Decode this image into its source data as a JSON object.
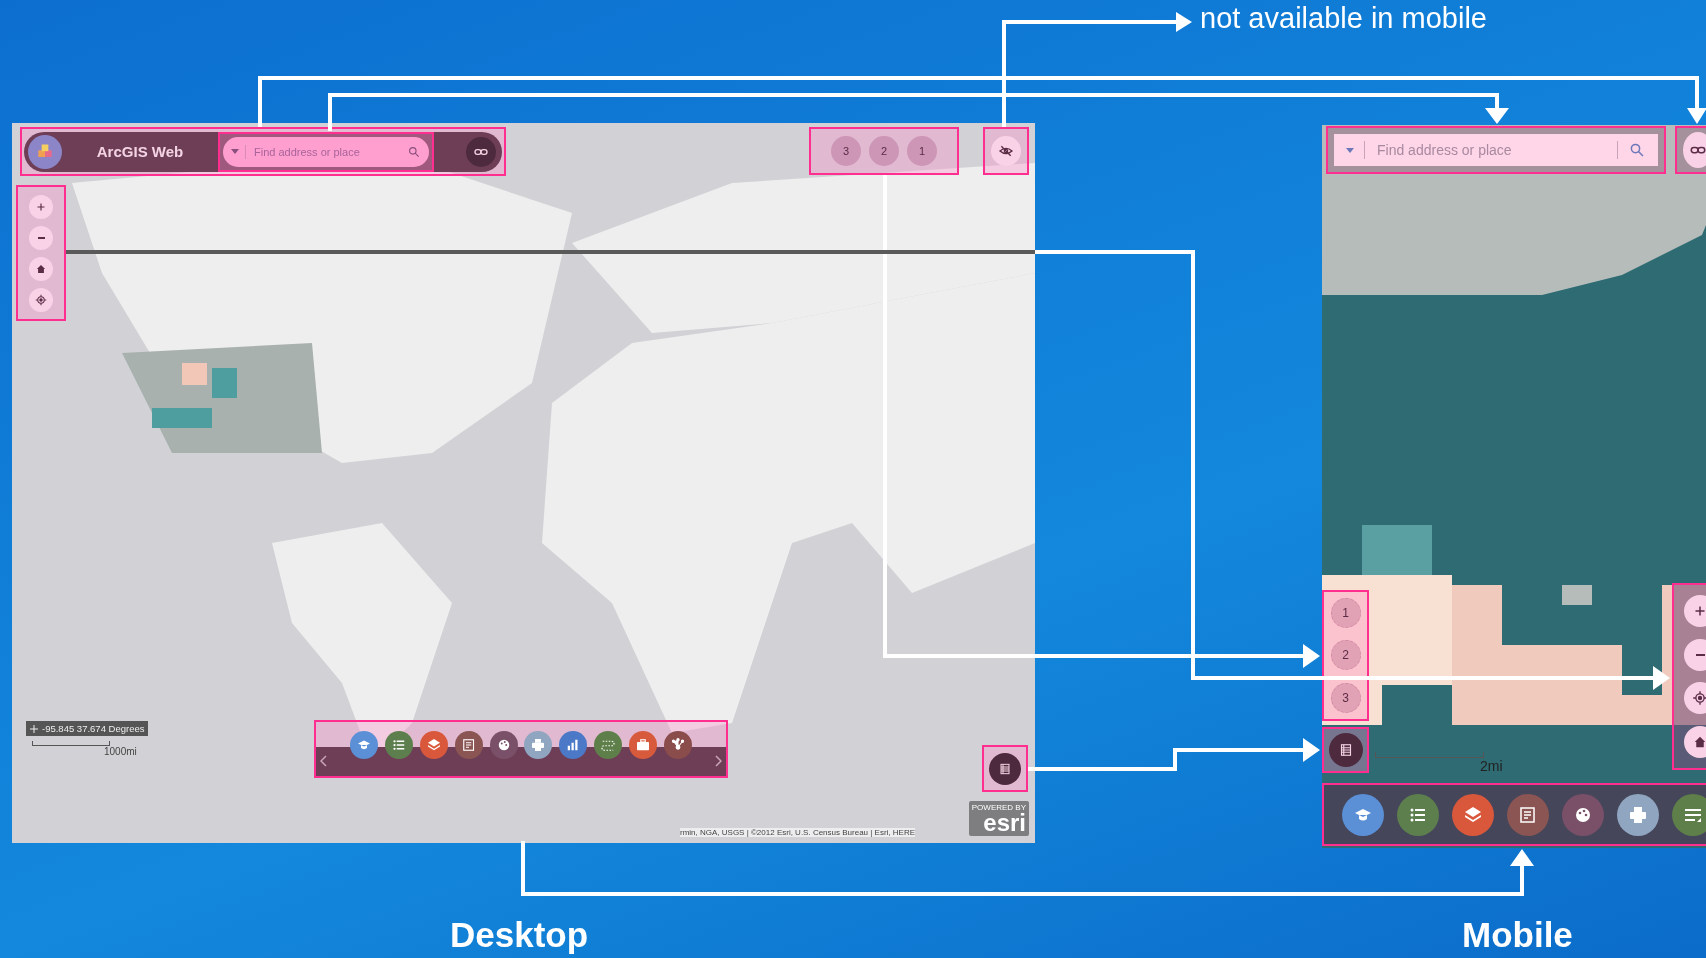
{
  "caption": "not available in mobile",
  "desktop": {
    "label": "Desktop",
    "header": {
      "title": "ArcGIS Web",
      "search": {
        "placeholder": "Find address or place"
      }
    },
    "bookmarks": [
      "3",
      "2",
      "1"
    ],
    "coordinates": "-95.845 37.674 Degrees",
    "scale": "1000mi",
    "attribution": "rmin, NGA, USGS | ©2012 Esri, U.S. Census Bureau | Esri, HERE",
    "logo": {
      "caption": "POWERED BY",
      "name": "esri"
    }
  },
  "mobile": {
    "label": "Mobile",
    "search": {
      "placeholder": "Find address or place"
    },
    "bookmarks": [
      "1",
      "2",
      "3"
    ],
    "scale": "2mi"
  }
}
